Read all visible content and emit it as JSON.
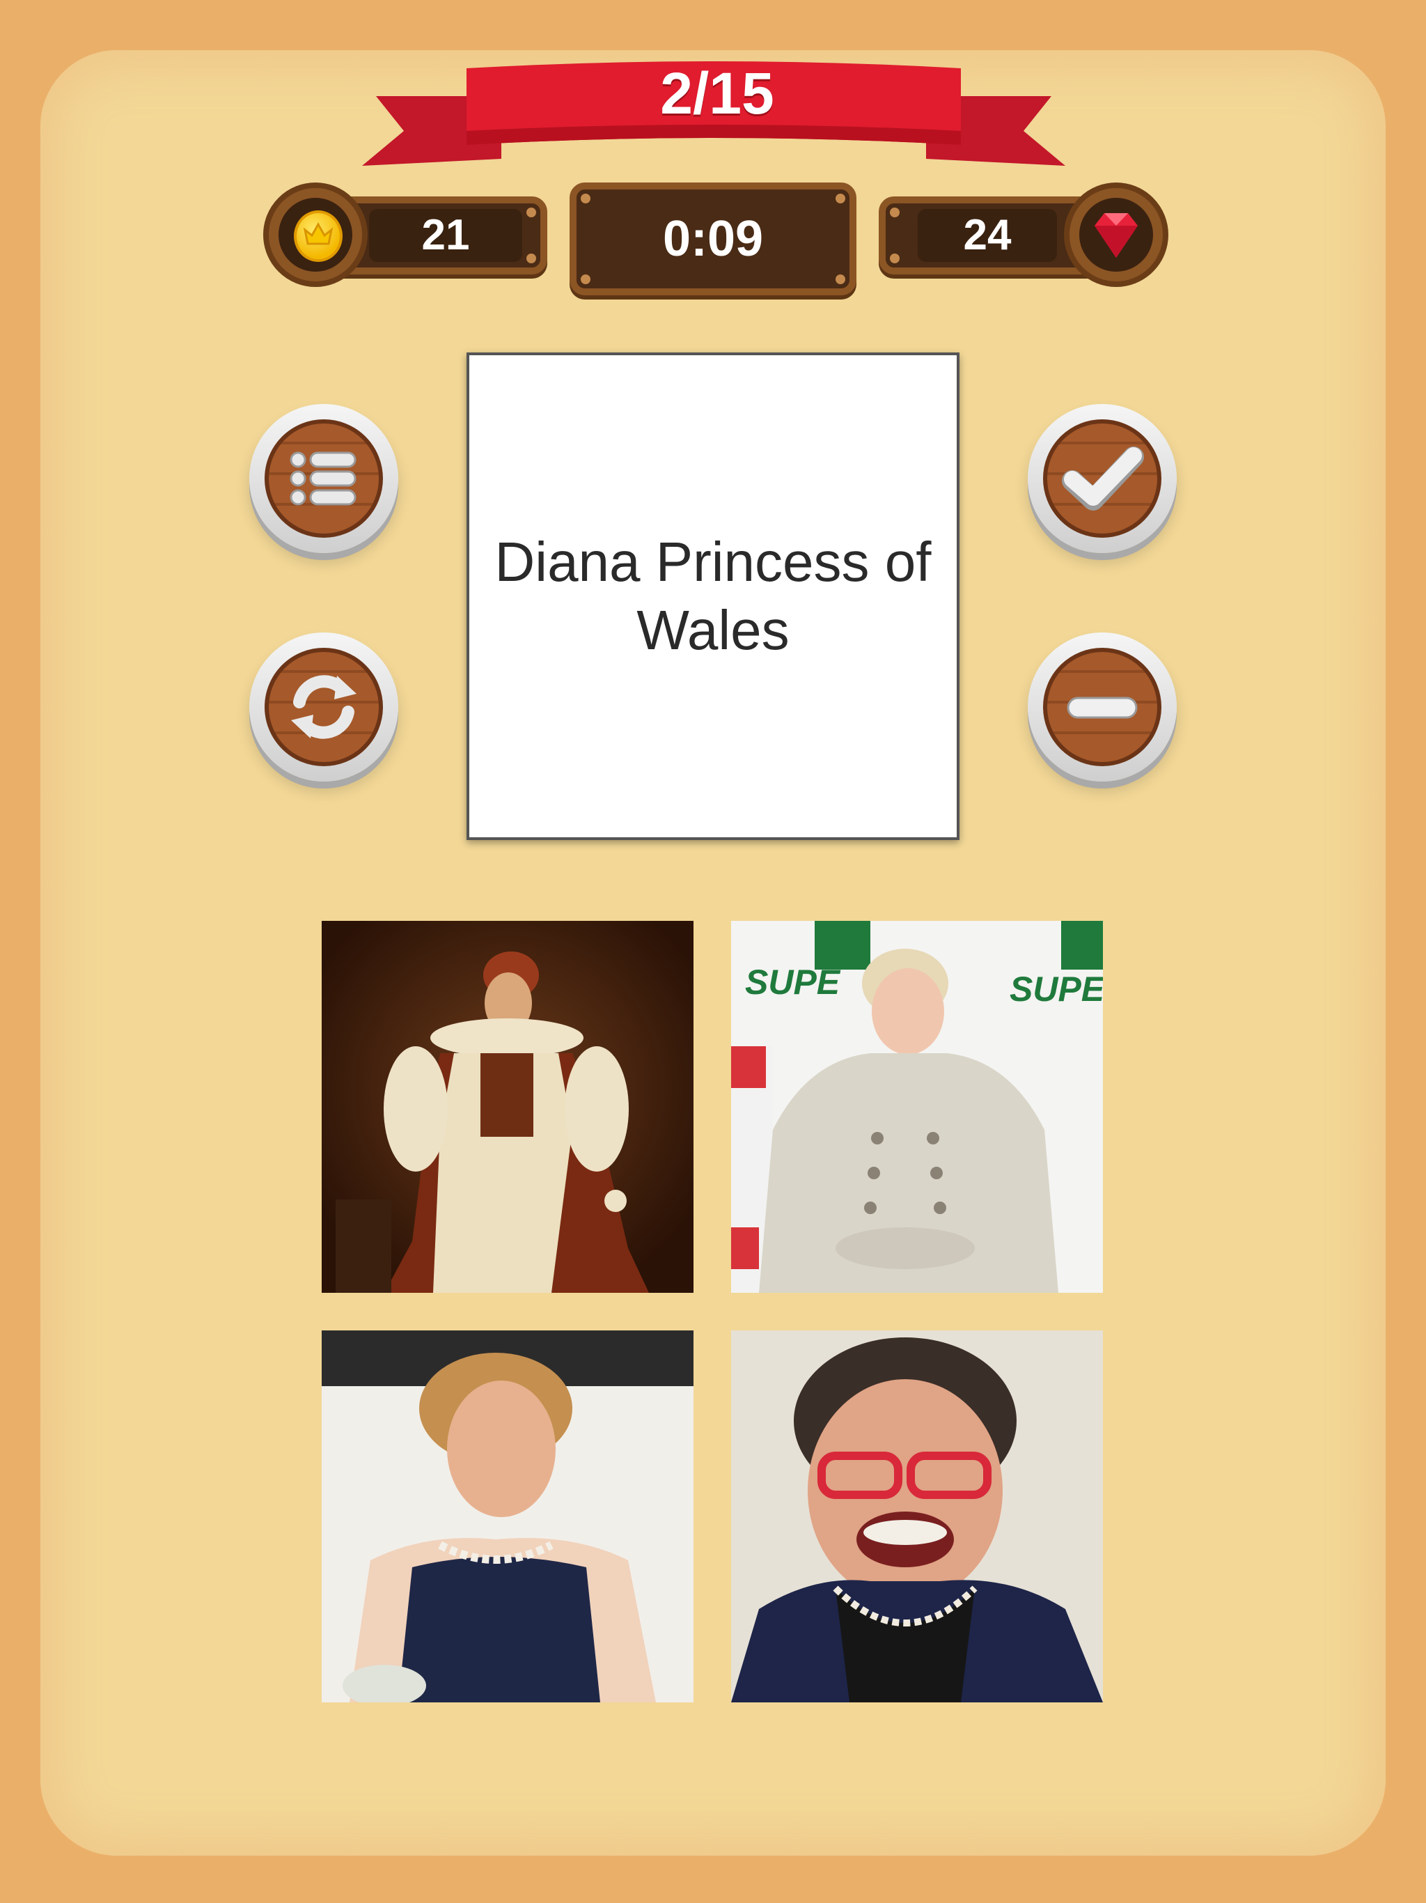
{
  "header": {
    "level": "2/15"
  },
  "stats": {
    "coins": "21",
    "timer": "0:09",
    "gems": "24"
  },
  "icons": {
    "coin": "coin-icon",
    "gem": "gem-icon",
    "list": "list-icon",
    "restart": "restart-icon",
    "check": "check-icon",
    "minus": "minus-icon"
  },
  "question": {
    "text": "Diana Princess of Wales"
  },
  "answers": [
    {
      "id": "answer-1",
      "description_icon": "portrait-painting"
    },
    {
      "id": "answer-2",
      "description_icon": "photo"
    },
    {
      "id": "answer-3",
      "description_icon": "photo"
    },
    {
      "id": "answer-4",
      "description_icon": "photo"
    }
  ],
  "colors": {
    "background": "#eab06a",
    "board": "#f2d796",
    "ribbon": "#e01c2e",
    "wood": "#4a2b15"
  }
}
